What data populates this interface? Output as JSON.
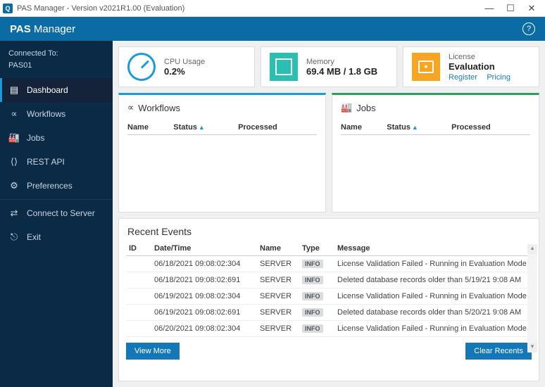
{
  "window": {
    "title": "PAS Manager - Version v2021R1.00 (Evaluation)"
  },
  "brand": {
    "bold": "PAS",
    "light": "Manager"
  },
  "connected": {
    "label": "Connected To:",
    "server": "PAS01"
  },
  "nav": {
    "dashboard": "Dashboard",
    "workflows": "Workflows",
    "jobs": "Jobs",
    "restapi": "REST API",
    "preferences": "Preferences",
    "connect": "Connect to Server",
    "exit": "Exit"
  },
  "cards": {
    "cpu": {
      "label": "CPU Usage",
      "value": "0.2%"
    },
    "memory": {
      "label": "Memory",
      "value": "69.4 MB / 1.8 GB"
    },
    "license": {
      "label": "License",
      "value": "Evaluation",
      "register": "Register",
      "pricing": "Pricing"
    }
  },
  "workflows_panel": {
    "title": "Workflows",
    "col_name": "Name",
    "col_status": "Status",
    "col_processed": "Processed"
  },
  "jobs_panel": {
    "title": "Jobs",
    "col_name": "Name",
    "col_status": "Status",
    "col_processed": "Processed"
  },
  "events": {
    "title": "Recent Events",
    "col_id": "ID",
    "col_dt": "Date/Time",
    "col_name": "Name",
    "col_type": "Type",
    "col_msg": "Message",
    "view_more": "View More",
    "clear": "Clear Recents",
    "rows": [
      {
        "dt": "06/18/2021 09:08:02:304",
        "name": "SERVER",
        "type": "INFO",
        "msg": "License Validation Failed - Running in Evaluation Mode"
      },
      {
        "dt": "06/18/2021 09:08:02:691",
        "name": "SERVER",
        "type": "INFO",
        "msg": "Deleted database records older than 5/19/21 9:08 AM"
      },
      {
        "dt": "06/19/2021 09:08:02:304",
        "name": "SERVER",
        "type": "INFO",
        "msg": "License Validation Failed - Running in Evaluation Mode"
      },
      {
        "dt": "06/19/2021 09:08:02:691",
        "name": "SERVER",
        "type": "INFO",
        "msg": "Deleted database records older than 5/20/21 9:08 AM"
      },
      {
        "dt": "06/20/2021 09:08:02:304",
        "name": "SERVER",
        "type": "INFO",
        "msg": "License Validation Failed - Running in Evaluation Mode"
      }
    ]
  }
}
